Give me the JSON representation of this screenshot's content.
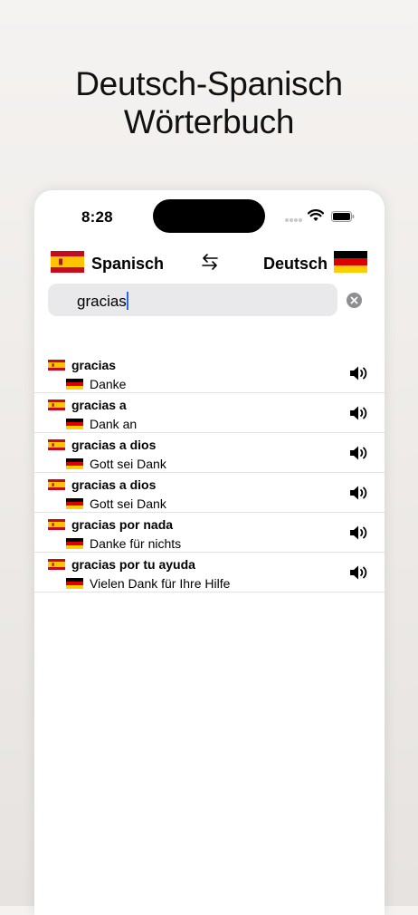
{
  "headline": {
    "line1": "Deutsch-Spanisch",
    "line2": "Wörterbuch"
  },
  "status_bar": {
    "time": "8:28"
  },
  "language_bar": {
    "source_language": "Spanisch",
    "target_language": "Deutsch"
  },
  "search": {
    "value": "gracias"
  },
  "results": [
    {
      "term": "gracias",
      "translation": "Danke"
    },
    {
      "term": "gracias a",
      "translation": "Dank an"
    },
    {
      "term": "gracias a dios",
      "translation": "Gott sei Dank"
    },
    {
      "term": "gracias a dios",
      "translation": "Gott sei Dank"
    },
    {
      "term": "gracias por nada",
      "translation": "Danke für nichts"
    },
    {
      "term": "gracias por tu ayuda",
      "translation": "Vielen Dank für Ihre Hilfe"
    }
  ],
  "colors": {
    "spain_red": "#c60b1e",
    "spain_yellow": "#ffc400",
    "germany_black": "#000000",
    "germany_red": "#dd0000",
    "germany_gold": "#ffce00",
    "caret": "#2a66e8",
    "search_bg": "#e9e9eb"
  },
  "icons": [
    "signal-icon",
    "wifi-icon",
    "battery-icon",
    "swap-languages-icon",
    "clear-search-icon",
    "speaker-icon"
  ]
}
